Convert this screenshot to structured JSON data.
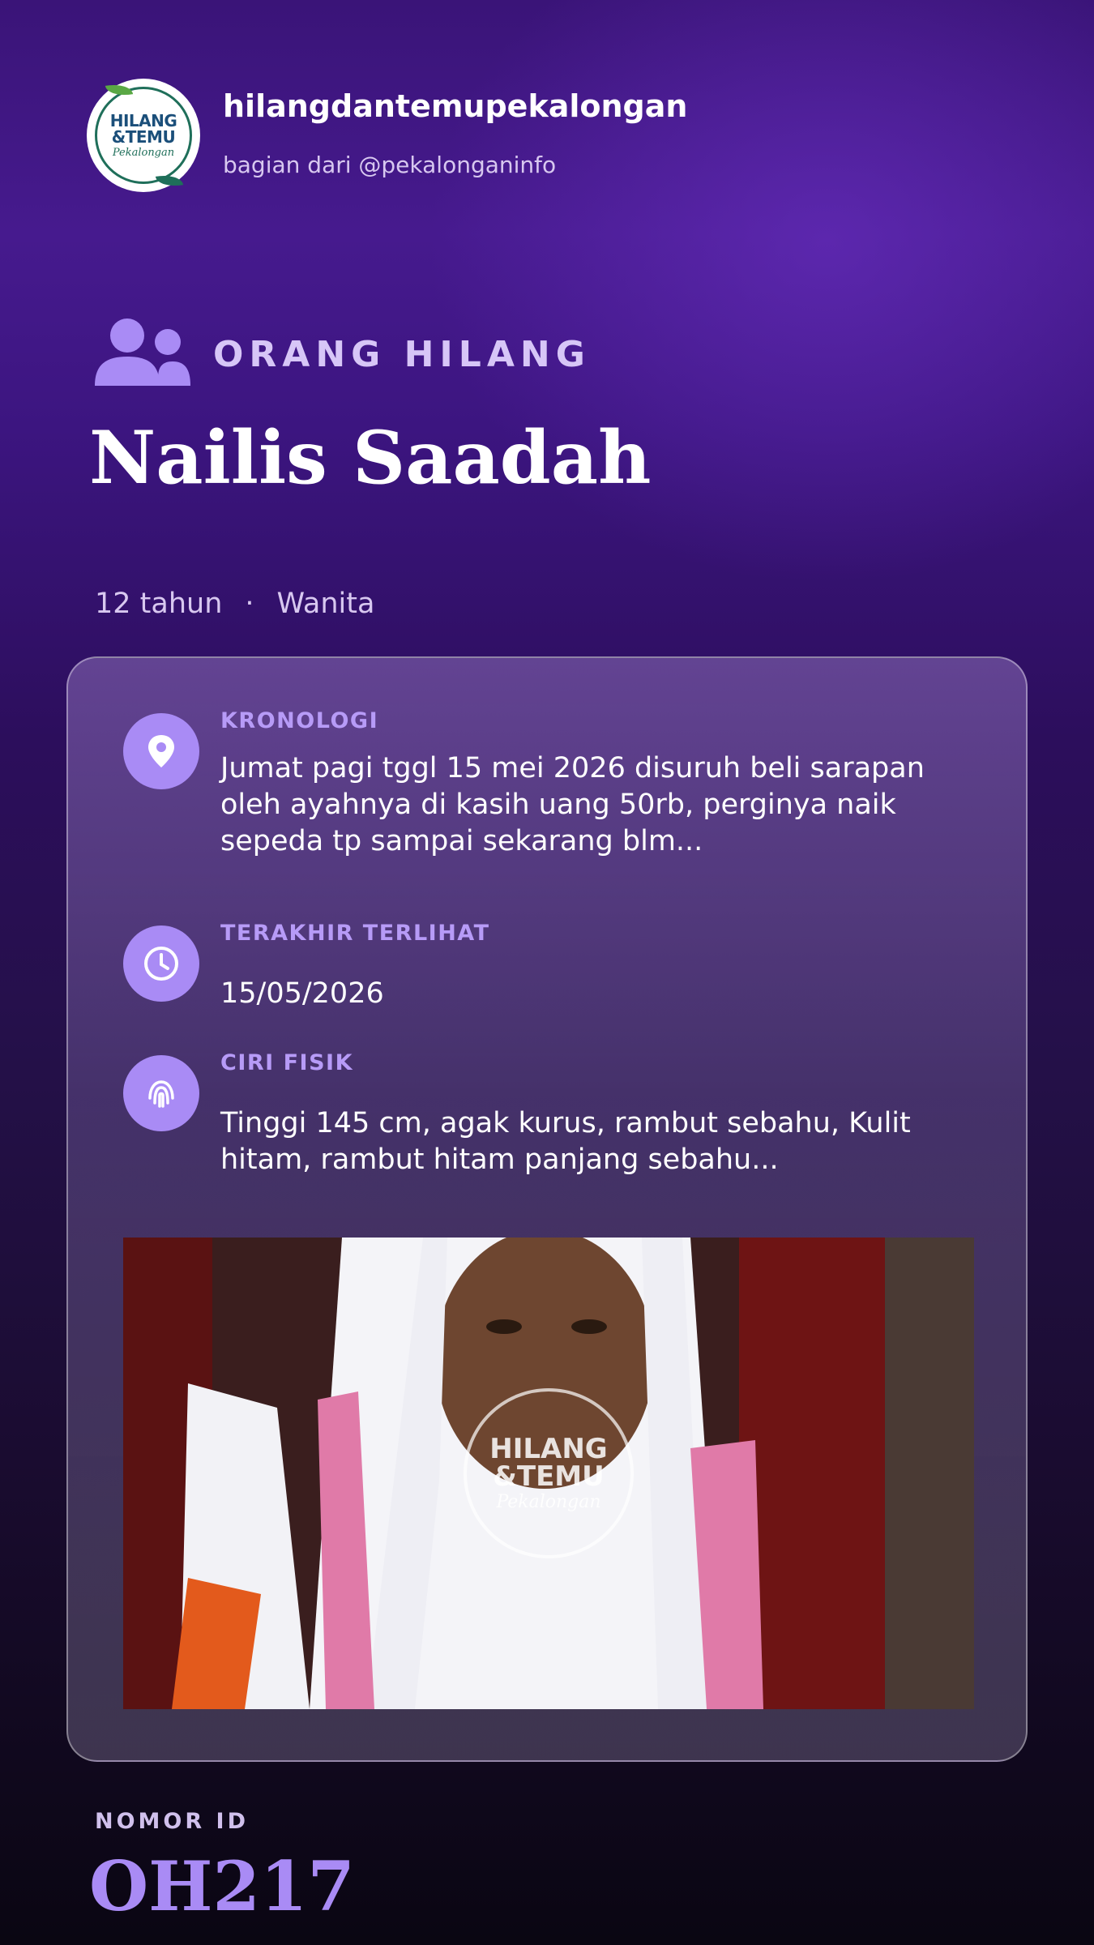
{
  "header": {
    "logo_text": {
      "line1": "HILANG",
      "line2": "&TEMU",
      "line3": "Pekalongan"
    },
    "account_name": "hilangdantemupekalongan",
    "account_sub": "bagian dari @pekalonganinfo"
  },
  "category": {
    "icon": "people-icon",
    "label": "ORANG HILANG"
  },
  "person": {
    "name": "Nailis Saadah",
    "age": "12 tahun",
    "separator": "·",
    "gender": "Wanita"
  },
  "details": {
    "kronologi": {
      "icon": "map-pin-icon",
      "label": "KRONOLOGI",
      "value": "Jumat pagi tggl 15 mei 2026 disuruh beli sarapan oleh ayahnya di kasih uang 50rb, perginya naik sepeda tp sampai sekarang blm..."
    },
    "terakhir_terlihat": {
      "icon": "clock-icon",
      "label": "TERAKHIR TERLIHAT",
      "value": "15/05/2026"
    },
    "ciri_fisik": {
      "icon": "fingerprint-icon",
      "label": "CIRI FISIK",
      "value": "Tinggi 145 cm, agak kurus, rambut sebahu, Kulit hitam, rambut hitam panjang sebahu..."
    }
  },
  "photo": {
    "watermark": {
      "line1": "HILANG",
      "line2": "&TEMU",
      "line3": "Pekalongan"
    }
  },
  "id": {
    "label": "NOMOR ID",
    "value": "OH217"
  },
  "colors": {
    "accent": "#a98bf5",
    "label": "#b79bf7",
    "background": "#3a1478"
  }
}
